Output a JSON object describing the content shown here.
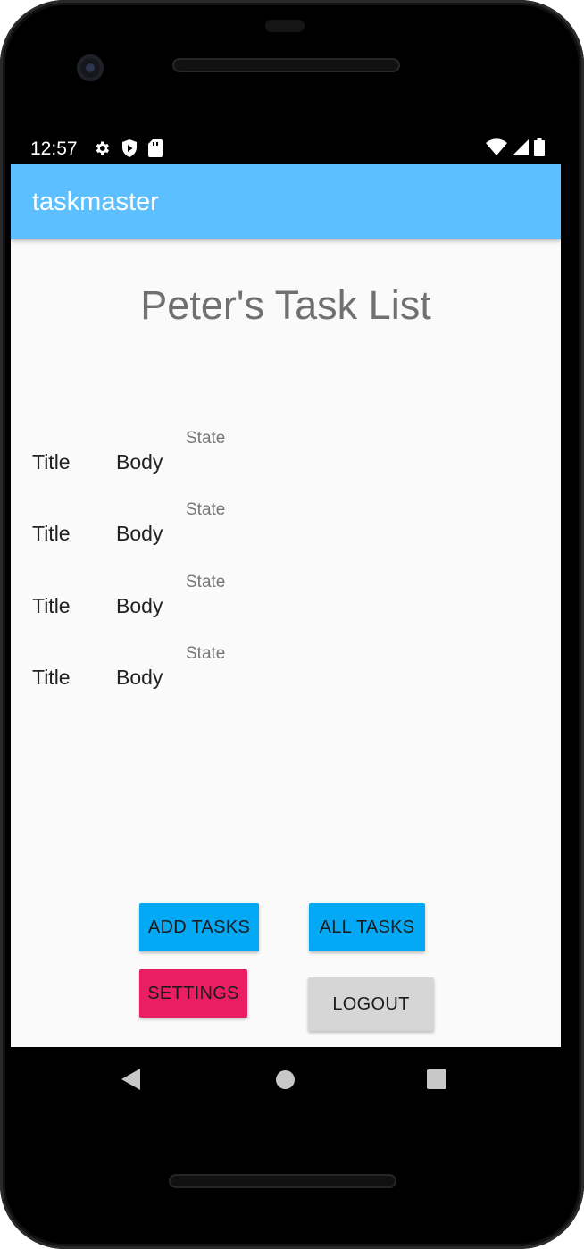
{
  "status_bar": {
    "time": "12:57",
    "left_icons": [
      "settings-gear-icon",
      "shield-play-icon",
      "sd-card-icon"
    ],
    "right_icons": [
      "wifi-icon",
      "cell-signal-icon",
      "battery-icon"
    ]
  },
  "app_bar": {
    "title": "taskmaster",
    "color": "#5cbfff"
  },
  "main": {
    "heading": "Peter's Task List",
    "tasks": [
      {
        "title": "Title",
        "body": "Body",
        "state": "State"
      },
      {
        "title": "Title",
        "body": "Body",
        "state": "State"
      },
      {
        "title": "Title",
        "body": "Body",
        "state": "State"
      },
      {
        "title": "Title",
        "body": "Body",
        "state": "State"
      }
    ]
  },
  "buttons": {
    "add_tasks": "ADD TASKS",
    "all_tasks": "ALL TASKS",
    "settings": "SETTINGS",
    "logout": "LOGOUT"
  },
  "colors": {
    "primary_button": "#03a9f4",
    "accent_button": "#e91e63",
    "neutral_button": "#d6d6d6"
  },
  "nav_bar": {
    "icons": [
      "back-icon",
      "home-icon",
      "recents-icon"
    ]
  }
}
